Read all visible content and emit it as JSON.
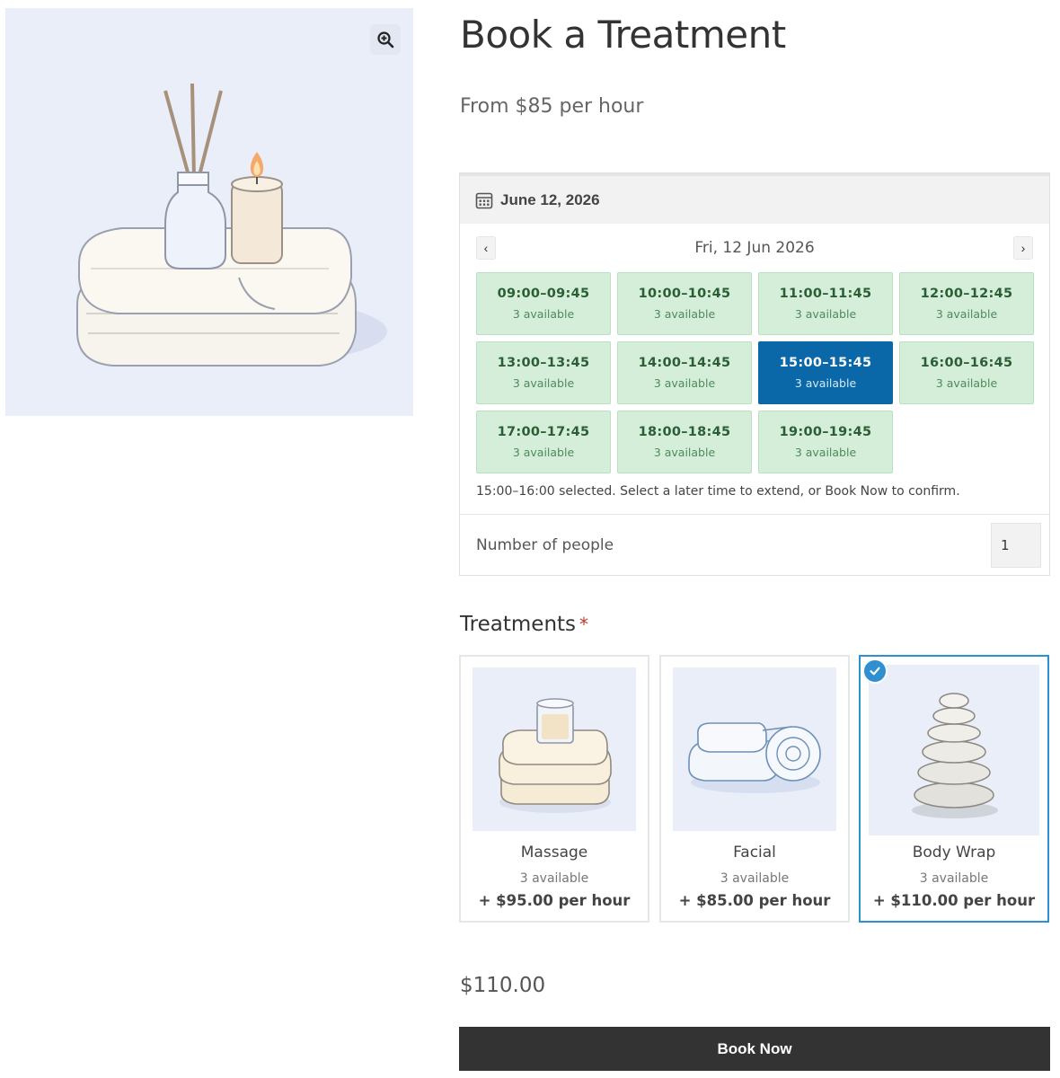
{
  "product": {
    "title": "Book a Treatment",
    "price_from": "From $85 per hour",
    "image_icon": "zoom-in-icon"
  },
  "booking": {
    "date_label": "June 12, 2026",
    "calendar_icon": "calendar-icon",
    "day_label": "Fri, 12 Jun 2026",
    "prev_label": "‹",
    "next_label": "›",
    "slots": [
      {
        "time": "09:00–09:45",
        "availability": "3 available",
        "selected": false
      },
      {
        "time": "10:00–10:45",
        "availability": "3 available",
        "selected": false
      },
      {
        "time": "11:00–11:45",
        "availability": "3 available",
        "selected": false
      },
      {
        "time": "12:00–12:45",
        "availability": "3 available",
        "selected": false
      },
      {
        "time": "13:00–13:45",
        "availability": "3 available",
        "selected": false
      },
      {
        "time": "14:00–14:45",
        "availability": "3 available",
        "selected": false
      },
      {
        "time": "15:00–15:45",
        "availability": "3 available",
        "selected": true
      },
      {
        "time": "16:00–16:45",
        "availability": "3 available",
        "selected": false
      },
      {
        "time": "17:00–17:45",
        "availability": "3 available",
        "selected": false
      },
      {
        "time": "18:00–18:45",
        "availability": "3 available",
        "selected": false
      },
      {
        "time": "19:00–19:45",
        "availability": "3 available",
        "selected": false
      }
    ],
    "selection_hint": "15:00–16:00 selected. Select a later time to extend, or Book Now to confirm.",
    "people_label": "Number of people",
    "people_value": "1"
  },
  "treatments": {
    "title": "Treatments",
    "required_mark": "*",
    "items": [
      {
        "name": "Massage",
        "availability": "3 available",
        "price": "+ $95.00 per hour",
        "selected": false
      },
      {
        "name": "Facial",
        "availability": "3 available",
        "price": "+ $85.00 per hour",
        "selected": false
      },
      {
        "name": "Body Wrap",
        "availability": "3 available",
        "price": "+ $110.00 per hour",
        "selected": true
      }
    ]
  },
  "total": "$110.00",
  "cta": {
    "label": "Book Now"
  },
  "colors": {
    "slot_bg": "#d4eed9",
    "slot_selected": "#0a67a8",
    "card_selected_border": "#2f8fd1",
    "button_bg": "#333333",
    "required": "#c0392b"
  }
}
